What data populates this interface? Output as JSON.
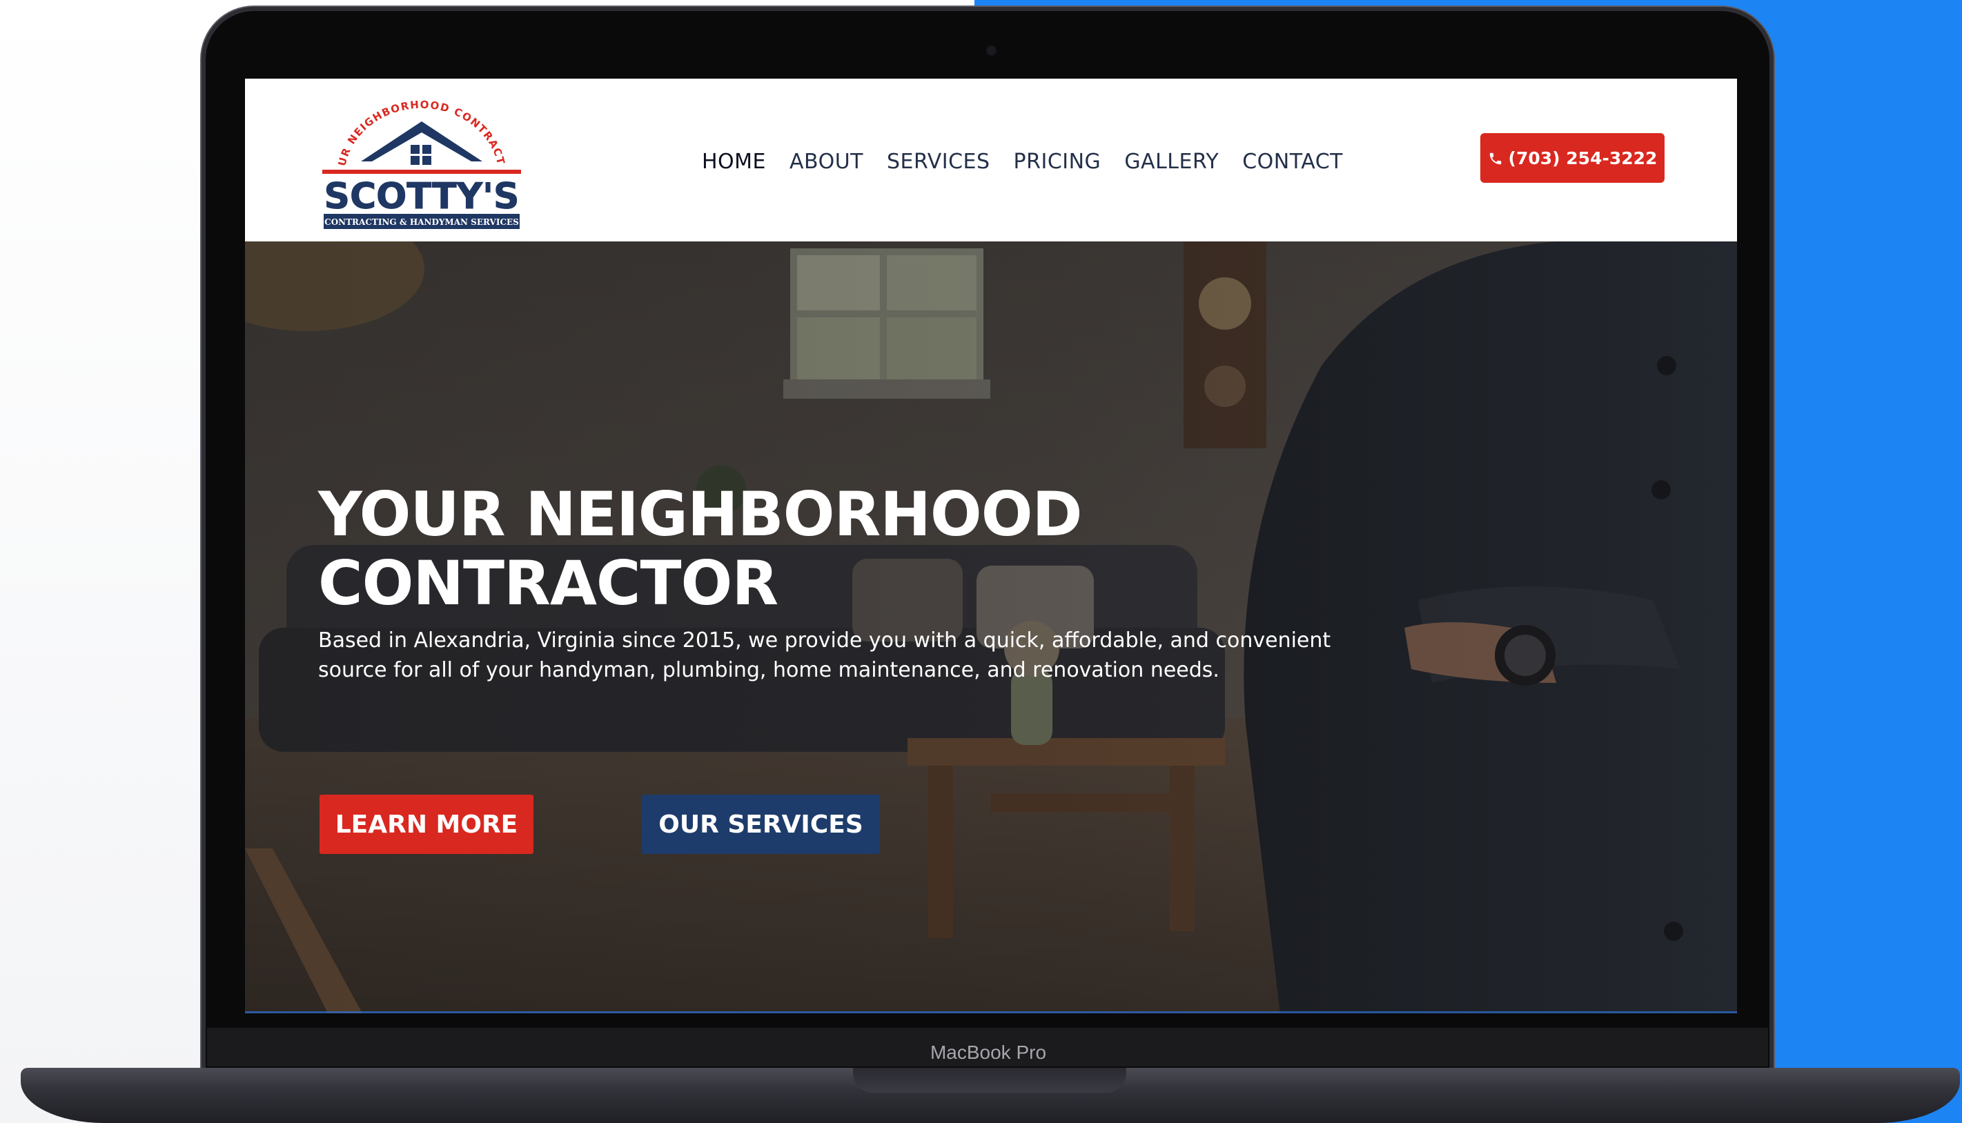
{
  "device": {
    "model_label": "MacBook Pro"
  },
  "logo": {
    "arc_text": "YOUR NEIGHBORHOOD CONTRACTOR",
    "brand": "SCOTTY'S",
    "tagline": "CONTRACTING & HANDYMAN SERVICES"
  },
  "nav": {
    "items": [
      {
        "label": "HOME",
        "active": true
      },
      {
        "label": "ABOUT",
        "active": false
      },
      {
        "label": "SERVICES",
        "active": false
      },
      {
        "label": "PRICING",
        "active": false
      },
      {
        "label": "GALLERY",
        "active": false
      },
      {
        "label": "CONTACT",
        "active": false
      }
    ]
  },
  "header": {
    "phone_label": "(703) 254-3222",
    "phone_icon": "phone-icon"
  },
  "hero": {
    "title_line1": "YOUR NEIGHBORHOOD",
    "title_line2": "CONTRACTOR",
    "description": "Based in Alexandria, Virginia since 2015, we provide you with a quick, affordable, and convenient source for all of your handyman, plumbing, home maintenance, and renovation needs.",
    "learn_more_label": "LEARN MORE",
    "our_services_label": "OUR SERVICES"
  },
  "colors": {
    "accent_red": "#d9281f",
    "navy": "#1d3c6b",
    "backdrop_blue": "#1d84f4"
  }
}
